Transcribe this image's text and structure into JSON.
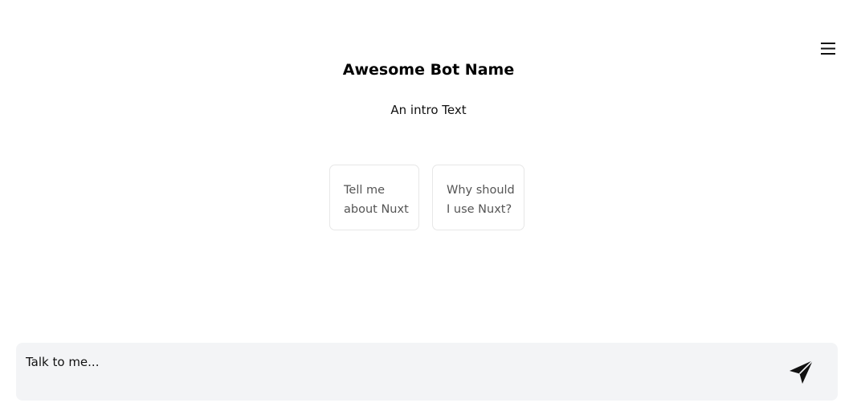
{
  "header": {
    "menu_icon": "hamburger-menu-icon"
  },
  "bot": {
    "name": "Awesome Bot Name",
    "intro": "An intro Text"
  },
  "suggestions": [
    {
      "lines": [
        "Tell me",
        "about Nuxt"
      ]
    },
    {
      "lines": [
        "Why should",
        "I use Nuxt?"
      ]
    }
  ],
  "composer": {
    "placeholder": "Talk to me...",
    "value": "",
    "send_icon": "paper-plane-send-icon"
  },
  "colors": {
    "background": "#ffffff",
    "composer_background": "#f3f4f6",
    "card_border": "#e7e7e7",
    "card_text": "#555555",
    "title_text": "#000000"
  }
}
